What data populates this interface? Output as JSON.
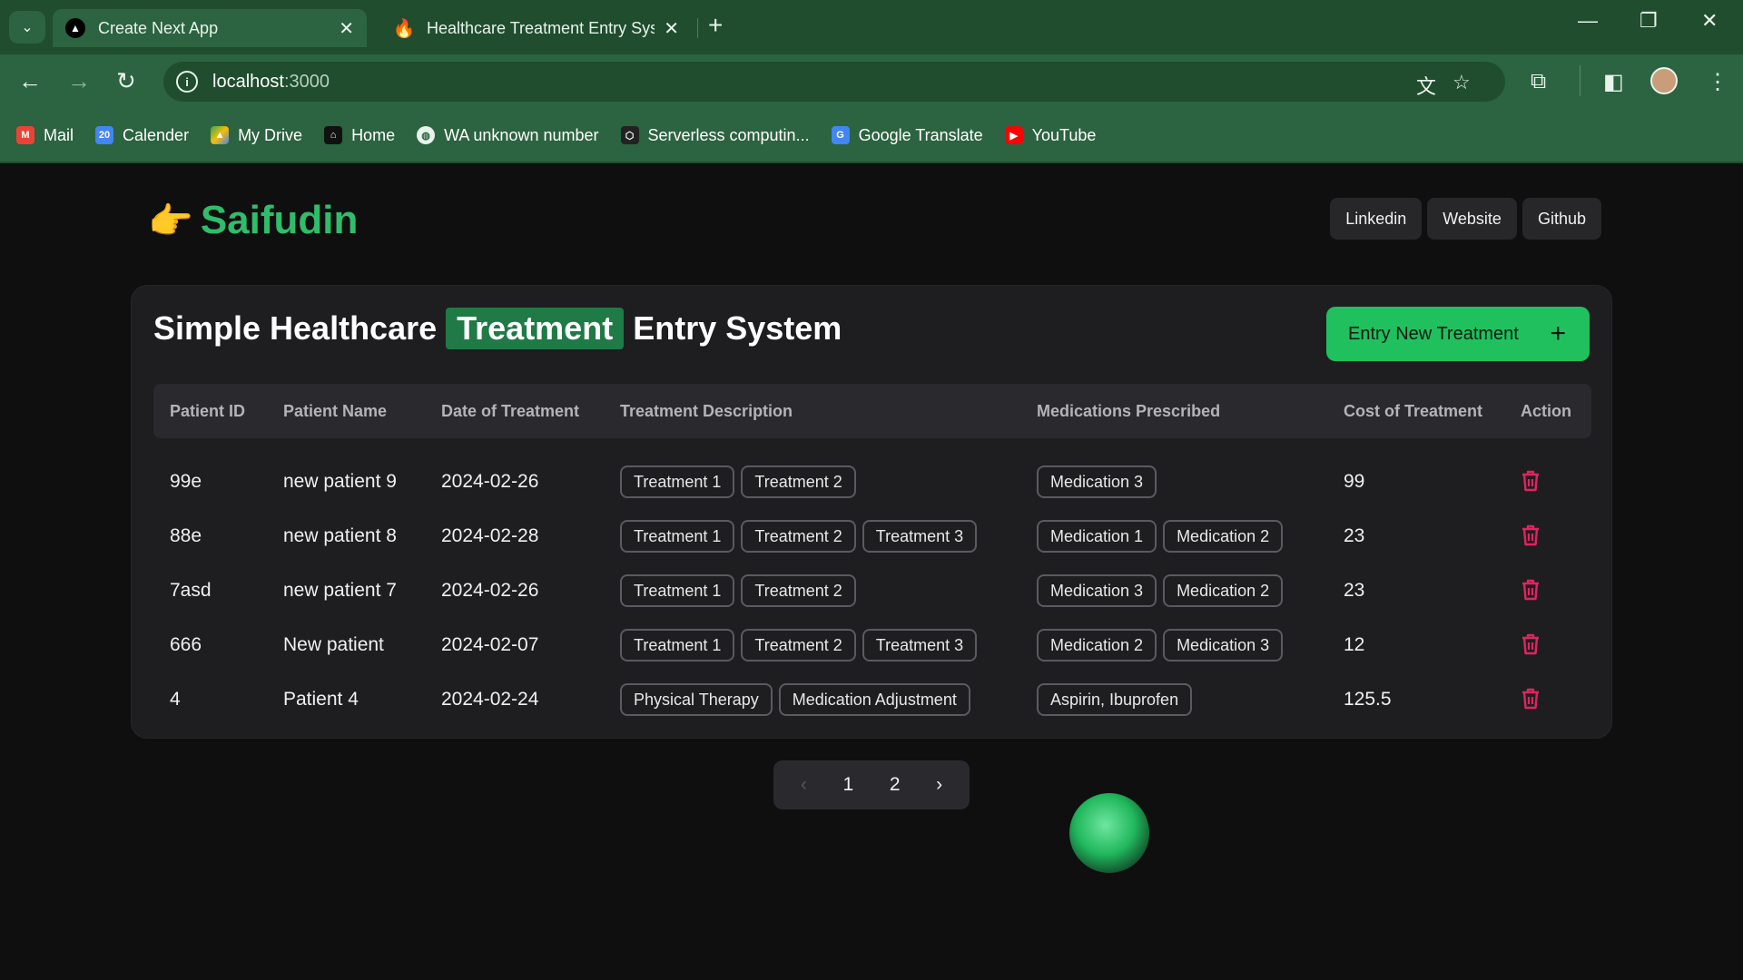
{
  "browser": {
    "tabs": [
      {
        "title": "Create Next App",
        "active": true,
        "icon": "nextjs-icon"
      },
      {
        "title": "Healthcare Treatment Entry Sys",
        "active": false,
        "icon": "firebase-icon"
      }
    ],
    "url_host": "localhost",
    "url_port": ":3000",
    "bookmarks": [
      {
        "label": "Mail",
        "icon": "gmail-icon",
        "color": "#ea4335"
      },
      {
        "label": "Calender",
        "icon": "calendar-icon",
        "color": "#4285f4"
      },
      {
        "label": "My Drive",
        "icon": "drive-icon",
        "color": "#fbbc04"
      },
      {
        "label": "Home",
        "icon": "home-icon",
        "color": "#111111"
      },
      {
        "label": "WA unknown number",
        "icon": "globe-icon",
        "color": "#ffffff"
      },
      {
        "label": "Serverless computin...",
        "icon": "serverless-icon",
        "color": "#222222"
      },
      {
        "label": "Google Translate",
        "icon": "translate-icon",
        "color": "#4285f4"
      },
      {
        "label": "YouTube",
        "icon": "youtube-icon",
        "color": "#ff0000"
      }
    ]
  },
  "header": {
    "logo_text": "Saifudin",
    "links": [
      "Linkedin",
      "Website",
      "Github"
    ]
  },
  "main": {
    "title_pre": "Simple Healthcare",
    "title_highlight": "Treatment",
    "title_post": "Entry System",
    "entry_button": "Entry New Treatment",
    "columns": [
      "Patient ID",
      "Patient Name",
      "Date of Treatment",
      "Treatment Description",
      "Medications Prescribed",
      "Cost of Treatment",
      "Action"
    ],
    "rows": [
      {
        "id": "99e",
        "name": "new patient 9",
        "date": "2024-02-26",
        "treatments": [
          "Treatment 1",
          "Treatment 2"
        ],
        "medications": [
          "Medication 3"
        ],
        "cost": "99"
      },
      {
        "id": "88e",
        "name": "new patient 8",
        "date": "2024-02-28",
        "treatments": [
          "Treatment 1",
          "Treatment 2",
          "Treatment 3"
        ],
        "medications": [
          "Medication 1",
          "Medication 2"
        ],
        "cost": "23"
      },
      {
        "id": "7asd",
        "name": "new patient 7",
        "date": "2024-02-26",
        "treatments": [
          "Treatment 1",
          "Treatment 2"
        ],
        "medications": [
          "Medication 3",
          "Medication 2"
        ],
        "cost": "23"
      },
      {
        "id": "666",
        "name": "New patient",
        "date": "2024-02-07",
        "treatments": [
          "Treatment 1",
          "Treatment 2",
          "Treatment 3"
        ],
        "medications": [
          "Medication 2",
          "Medication 3"
        ],
        "cost": "12"
      },
      {
        "id": "4",
        "name": "Patient 4",
        "date": "2024-02-24",
        "treatments": [
          "Physical Therapy",
          "Medication Adjustment"
        ],
        "medications": [
          "Aspirin, Ibuprofen"
        ],
        "cost": "125.5"
      }
    ],
    "pagination": {
      "pages": [
        "1",
        "2"
      ],
      "prev": "‹",
      "next": "›"
    }
  },
  "colors": {
    "accent": "#21c05e",
    "brand": "#2fbd6b",
    "danger": "#e0245e",
    "chrome": "#2c6340"
  }
}
